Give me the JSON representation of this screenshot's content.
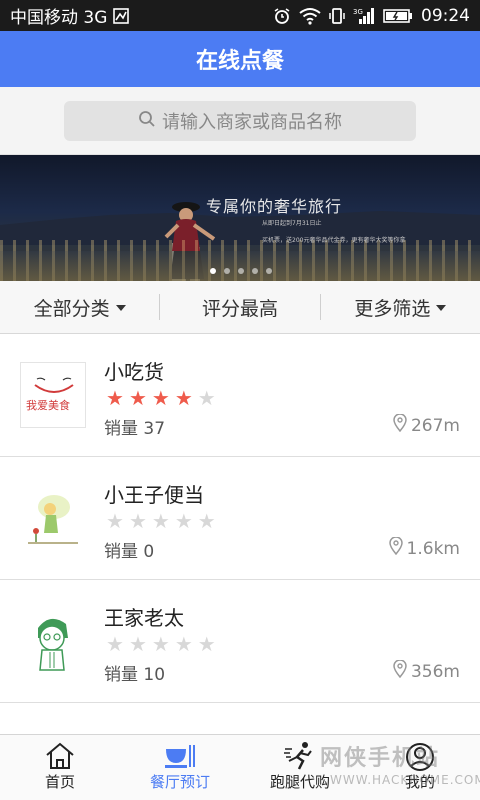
{
  "status_bar": {
    "carrier": "中国移动 3G",
    "time": "09:24",
    "icons": [
      "sim-card-icon",
      "alarm-icon",
      "wifi-icon",
      "vibrate-icon",
      "signal-icon",
      "battery-icon"
    ]
  },
  "header": {
    "title": "在线点餐"
  },
  "search": {
    "placeholder": "请输入商家或商品名称",
    "icon": "search-icon"
  },
  "banner": {
    "tagline": "专属你的奢华旅行",
    "subline": "从即日起到7月31日止",
    "subline2": "买机票，送200元奢华品代金券，更有奢华大奖等你拿",
    "slide_count": 5,
    "active_slide": 1
  },
  "filters": {
    "all_categories": "全部分类",
    "top_rated": "评分最高",
    "more_filters": "更多筛选"
  },
  "restaurants": [
    {
      "name": "小吃货",
      "rating": 4,
      "max_rating": 5,
      "sales_label": "销量 37",
      "distance": "267m",
      "logo_text": "我爱美食"
    },
    {
      "name": "小王子便当",
      "rating": 0,
      "max_rating": 5,
      "sales_label": "销量 0",
      "distance": "1.6km"
    },
    {
      "name": "王家老太",
      "rating": 0,
      "max_rating": 5,
      "sales_label": "销量 10",
      "distance": "356m"
    },
    {
      "name": ""
    }
  ],
  "tabs": [
    {
      "label": "首页",
      "icon": "home-icon"
    },
    {
      "label": "餐厅预订",
      "icon": "dining-icon",
      "active": true
    },
    {
      "label": "跑腿代购",
      "icon": "runner-icon"
    },
    {
      "label": "我的",
      "icon": "profile-icon"
    }
  ],
  "watermark": {
    "text": "网侠手机站",
    "url": "WWW.HACKHOME.COM"
  },
  "colors": {
    "accent": "#4c7cf3",
    "star_on": "#ef5b4c",
    "star_off": "#d8d8d8"
  }
}
